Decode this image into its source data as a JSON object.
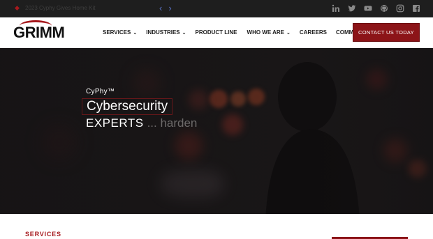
{
  "topbar": {
    "announcement": "2023 Cyphy Gives Home Kit",
    "prev_arrow": "‹",
    "next_arrow": "›",
    "socials": [
      "linkedin-icon",
      "twitter-icon",
      "youtube-icon",
      "github-icon",
      "instagram-icon",
      "facebook-icon"
    ]
  },
  "header": {
    "logo": "GRIMM",
    "nav": [
      {
        "label": "SERVICES",
        "dropdown": true
      },
      {
        "label": "INDUSTRIES",
        "dropdown": true
      },
      {
        "label": "PRODUCT LINE",
        "dropdown": false
      },
      {
        "label": "WHO WE ARE",
        "dropdown": true
      },
      {
        "label": "CAREERS",
        "dropdown": false
      },
      {
        "label": "COMMUNITY",
        "dropdown": false
      }
    ],
    "cta_label": "CONTACT US TODAY"
  },
  "hero": {
    "subtitle": "CyPhy™",
    "title": "Cybersecurity",
    "line2_strong": "EXPERTS",
    "line2_typed": "... harden"
  },
  "section": {
    "title": "SERVICES"
  },
  "colors": {
    "brand_red": "#a6191d",
    "cta_bg": "#8c1418",
    "topbar_bg": "#1e1e1e",
    "hero_bg": "#1a1718"
  }
}
